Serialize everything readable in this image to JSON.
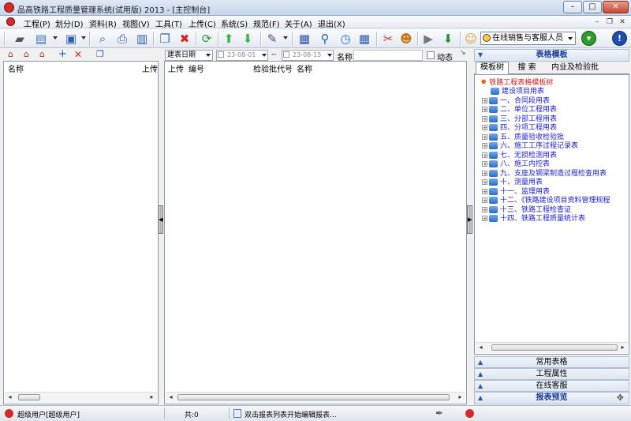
{
  "window": {
    "title": "品高铁路工程质量管理系统(试用版) 2013 - [主控制台]",
    "min": "–",
    "max": "□",
    "close": "✕"
  },
  "menu": [
    {
      "label": "工程(P)"
    },
    {
      "label": "划分(D)"
    },
    {
      "label": "资料(R)"
    },
    {
      "label": "视图(V)"
    },
    {
      "label": "工具(T)"
    },
    {
      "label": "上传(C)"
    },
    {
      "label": "系统(S)"
    },
    {
      "label": "规范(F)"
    },
    {
      "label": "关于(A)"
    },
    {
      "label": "退出(X)"
    }
  ],
  "toolbar": {
    "service_select": "在线销售与客服人员",
    "go_label": "▾",
    "info_label": "!"
  },
  "left_panel": {
    "columns": [
      "名称",
      "上传"
    ],
    "scroll_left": "◂",
    "scroll_right": "▸"
  },
  "filter": {
    "date_type": "建表日期",
    "date_from": "23-08-01",
    "separator": "--",
    "date_to": "23-08-15",
    "name_label": "名称",
    "name_value": "",
    "dynamic_label": "动态"
  },
  "center_panel": {
    "columns": [
      "上传",
      "编号",
      "检验批代号",
      "名称"
    ]
  },
  "right_panel": {
    "header": "表格模板",
    "tabs": [
      "模板树",
      "搜  索",
      "内业及检验批"
    ],
    "tree_root": "铁路工程表格模板树",
    "tree_items": [
      {
        "label": "建设项目用表",
        "expandable": false
      },
      {
        "label": "一、合同段用表",
        "expandable": true
      },
      {
        "label": "二、单位工程用表",
        "expandable": true
      },
      {
        "label": "三、分部工程用表",
        "expandable": true
      },
      {
        "label": "四、分项工程用表",
        "expandable": true
      },
      {
        "label": "五、质量验收检验批",
        "expandable": true
      },
      {
        "label": "六、施工工序过程记录表",
        "expandable": true
      },
      {
        "label": "七、无损检测用表",
        "expandable": true
      },
      {
        "label": "八、施工内控表",
        "expandable": true
      },
      {
        "label": "九、支座及钢梁制造过程检查用表",
        "expandable": true
      },
      {
        "label": "十、测量用表",
        "expandable": true
      },
      {
        "label": "十一、监理用表",
        "expandable": true
      },
      {
        "label": "十二、《铁路建设项目资料管理规程",
        "expandable": true
      },
      {
        "label": "十三、铁路工程检查证",
        "expandable": true
      },
      {
        "label": "十四、铁路工程质量统计表",
        "expandable": true
      }
    ],
    "sections": [
      "常用表格",
      "工程属性",
      "在线客服",
      "报表预览"
    ]
  },
  "status": {
    "user": "超级用户[超级用户]",
    "count": "共:0",
    "hint": "双击报表列表开始编辑报表..."
  },
  "colors": {
    "accent": "#2a5aa8",
    "tree_text": "#1a1adb",
    "root_text": "#d42020"
  }
}
